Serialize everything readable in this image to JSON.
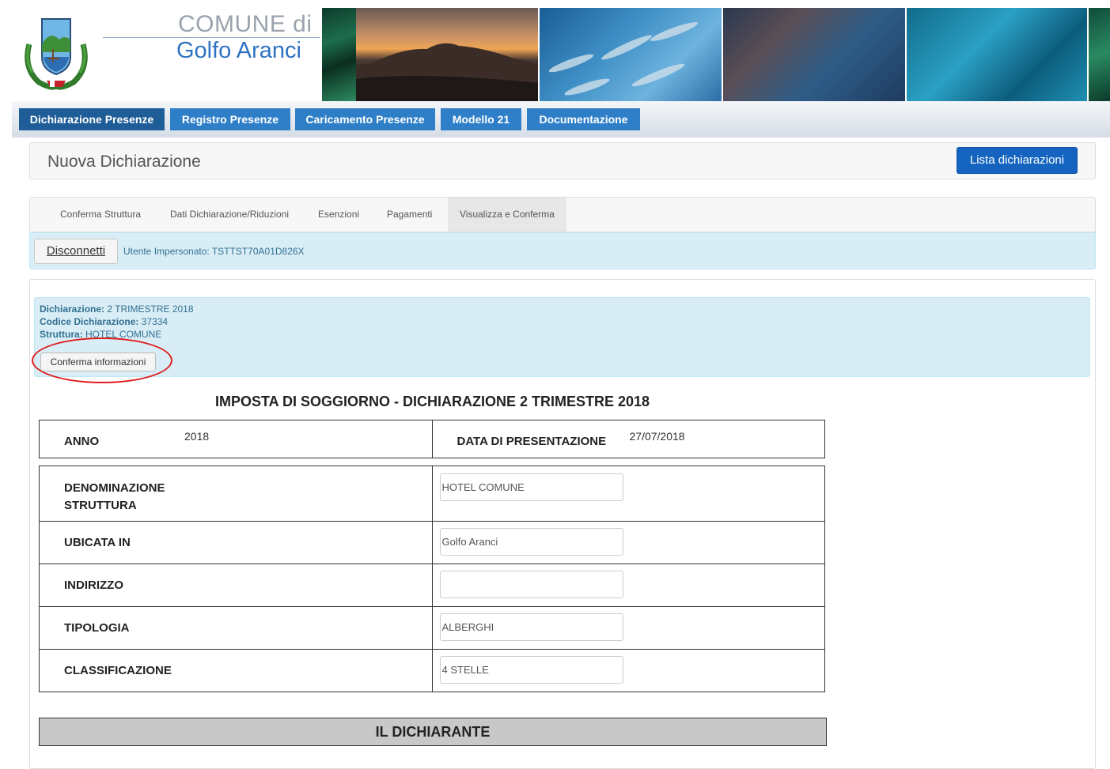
{
  "header": {
    "comune_di": "COMUNE di",
    "town": "Golfo Aranci"
  },
  "nav": {
    "tabs": [
      {
        "label": "Dichiarazione Presenze",
        "active": true
      },
      {
        "label": "Registro Presenze",
        "active": false
      },
      {
        "label": "Caricamento Presenze",
        "active": false
      },
      {
        "label": "Modello 21",
        "active": false
      },
      {
        "label": "Documentazione",
        "active": false
      }
    ]
  },
  "page": {
    "title": "Nuova Dichiarazione",
    "list_button": "Lista dichiarazioni"
  },
  "steps": [
    {
      "label": "Conferma Struttura",
      "active": false
    },
    {
      "label": "Dati Dichiarazione/Riduzioni",
      "active": false
    },
    {
      "label": "Esenzioni",
      "active": false
    },
    {
      "label": "Pagamenti",
      "active": false
    },
    {
      "label": "Visualizza e Conferma",
      "active": true
    }
  ],
  "session": {
    "disconnect_label": "Disconnetti",
    "impersonated_user": "Utente Impersonato: TSTTST70A01D826X"
  },
  "info": {
    "dichiarazione_label": "Dichiarazione:",
    "dichiarazione_value": "2 TRIMESTRE 2018",
    "codice_label": "Codice Dichiarazione:",
    "codice_value": "37334",
    "struttura_label": "Struttura:",
    "struttura_value": "HOTEL COMUNE",
    "confirm_button": "Conferma informazioni"
  },
  "form": {
    "title": "IMPOSTA DI SOGGIORNO - DICHIARAZIONE 2 TRIMESTRE 2018",
    "anno_label": "ANNO",
    "anno_value": "2018",
    "data_label": "DATA DI PRESENTAZIONE",
    "data_value": "27/07/2018",
    "rows": [
      {
        "label": "DENOMINAZIONE STRUTTURA",
        "value": "HOTEL COMUNE"
      },
      {
        "label": "UBICATA IN",
        "value": "Golfo Aranci"
      },
      {
        "label": "INDIRIZZO",
        "value": ""
      },
      {
        "label": "TIPOLOGIA",
        "value": "ALBERGHI"
      },
      {
        "label": "CLASSIFICAZIONE",
        "value": "4 STELLE"
      }
    ],
    "section_dichiarante": "IL DICHIARANTE"
  },
  "colors": {
    "nav_tab": "#2e7fc8",
    "nav_tab_active": "#1e5d97",
    "primary_button": "#1565c0",
    "info_bg": "#d9edf7",
    "annotation_circle": "#e01b1b"
  }
}
